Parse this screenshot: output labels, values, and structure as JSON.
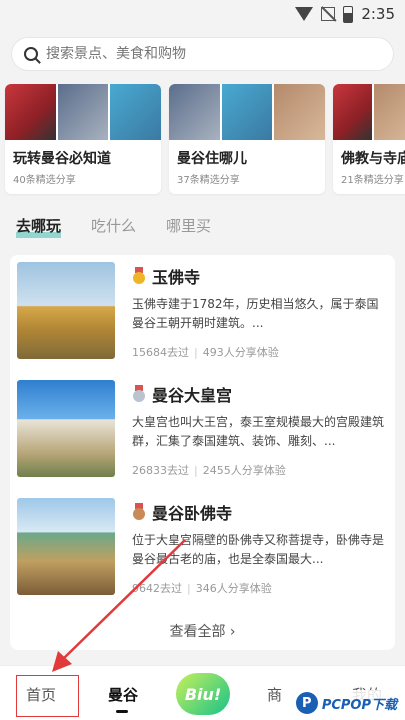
{
  "status": {
    "time": "2:35"
  },
  "search": {
    "placeholder": "搜索景点、美食和购物"
  },
  "guides": [
    {
      "title": "玩转曼谷必知道",
      "sub": "40条精选分享"
    },
    {
      "title": "曼谷住哪儿",
      "sub": "37条精选分享"
    },
    {
      "title": "佛教与寺庙",
      "sub": "21条精选分享"
    }
  ],
  "tabs": [
    "去哪玩",
    "吃什么",
    "哪里买"
  ],
  "pois": [
    {
      "name": "玉佛寺",
      "desc": "玉佛寺建于1782年，历史相当悠久，属于泰国曼谷王朝开朝时建筑。...",
      "visited": "15684去过",
      "shared": "493人分享体验"
    },
    {
      "name": "曼谷大皇宫",
      "desc": "大皇宫也叫大王宫，泰王室规模最大的宫殿建筑群，汇集了泰国建筑、装饰、雕刻、...",
      "visited": "26833去过",
      "shared": "2455人分享体验"
    },
    {
      "name": "曼谷卧佛寺",
      "desc": "位于大皇宫隔壁的卧佛寺又称菩提寺，卧佛寺是曼谷最古老的庙，也是全泰国最大...",
      "visited": "9642去过",
      "shared": "346人分享体验"
    }
  ],
  "view_all": "查看全部 ›",
  "nav": {
    "home": "首页",
    "bangkok": "曼谷",
    "biu": "Biu!",
    "shop": "商",
    "mine": "我的"
  },
  "watermark": {
    "logo": "P",
    "text": "PCPOP下载"
  },
  "colors": {
    "accent": "#42beb0",
    "annotation": "#e23a3a"
  }
}
